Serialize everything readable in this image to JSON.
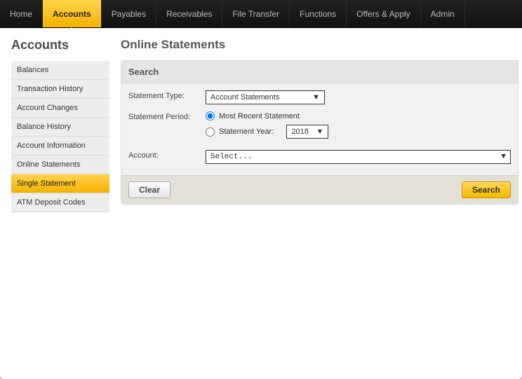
{
  "topnav": {
    "items": [
      {
        "label": "Home"
      },
      {
        "label": "Accounts",
        "active": true
      },
      {
        "label": "Payables"
      },
      {
        "label": "Receivables"
      },
      {
        "label": "File Transfer"
      },
      {
        "label": "Functions"
      },
      {
        "label": "Offers & Apply"
      },
      {
        "label": "Admin"
      }
    ]
  },
  "sidebar": {
    "title": "Accounts",
    "items": [
      {
        "label": "Balances"
      },
      {
        "label": "Transaction History"
      },
      {
        "label": "Account Changes"
      },
      {
        "label": "Balance History"
      },
      {
        "label": "Account Information"
      },
      {
        "label": "Online Statements"
      },
      {
        "label": "Single Statement",
        "active": true
      },
      {
        "label": "ATM Deposit Codes"
      }
    ]
  },
  "main": {
    "title": "Online Statements",
    "search": {
      "header": "Search",
      "type_label": "Statement Type:",
      "type_value": "Account Statements",
      "period_label": "Statement Period:",
      "period_option_recent": "Most Recent Statement",
      "period_option_year": "Statement Year:",
      "period_year_value": "2018",
      "account_label": "Account:",
      "account_value": "Select...",
      "clear_label": "Clear",
      "search_label": "Search"
    }
  }
}
